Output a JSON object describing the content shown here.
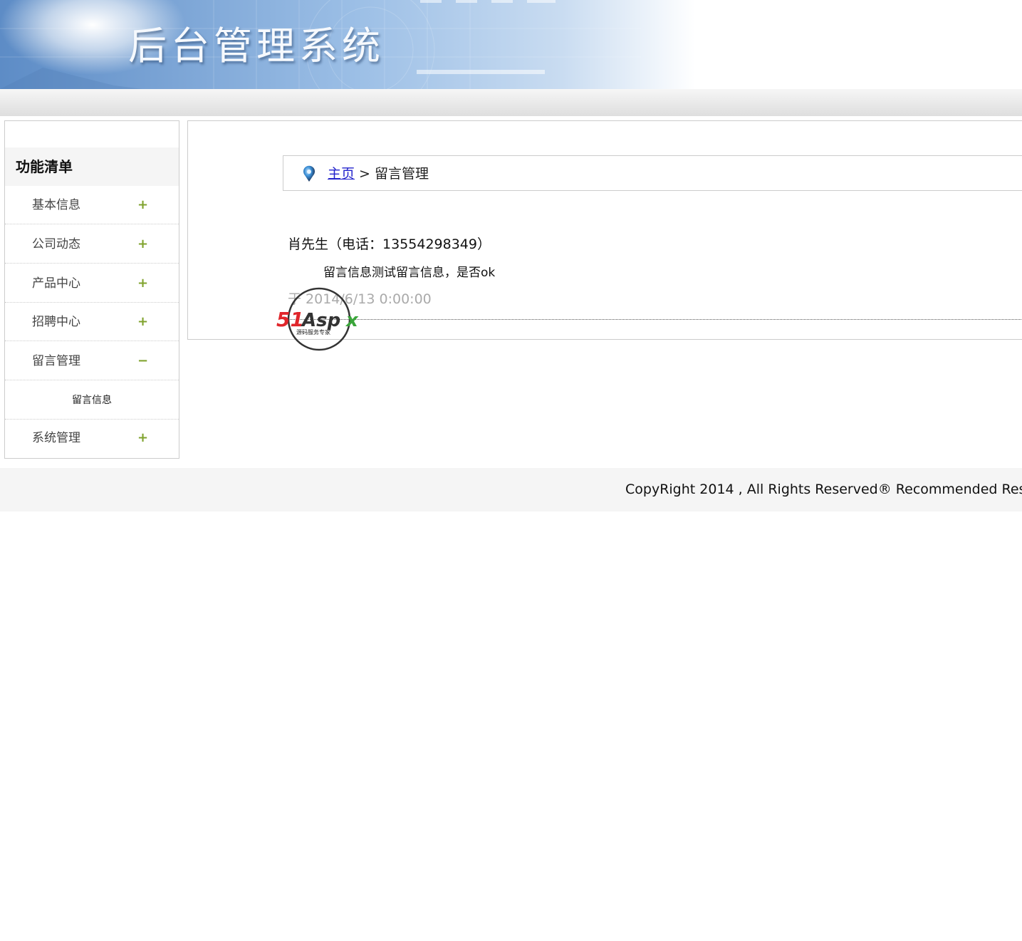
{
  "banner": {
    "title": "后台管理系统"
  },
  "sidebar": {
    "header": "功能清单",
    "items": [
      {
        "label": "基本信息",
        "toggle": "+"
      },
      {
        "label": "公司动态",
        "toggle": "+"
      },
      {
        "label": "产品中心",
        "toggle": "+"
      },
      {
        "label": "招聘中心",
        "toggle": "+"
      },
      {
        "label": "留言管理",
        "toggle": "−",
        "expanded": true,
        "children": [
          {
            "label": "留言信息"
          }
        ]
      },
      {
        "label": "系统管理",
        "toggle": "+"
      }
    ]
  },
  "breadcrumb": {
    "home": "主页",
    "separator": " > ",
    "current": "留言管理"
  },
  "message": {
    "author": "肖先生（电话：13554298349）",
    "body": "留言信息测试留言信息，是否ok",
    "time": "于 2014/6/13 0:00:00"
  },
  "watermark": {
    "brand": "51Aspx",
    "tagline": "源码服务专家"
  },
  "footer": {
    "copyright": "CopyRight 2014 , All Rights Reserved® Recommended Res"
  },
  "colors": {
    "accent_green": "#7fa22c",
    "link_blue": "#2222cc",
    "banner_blue": "#7ea7d8"
  }
}
